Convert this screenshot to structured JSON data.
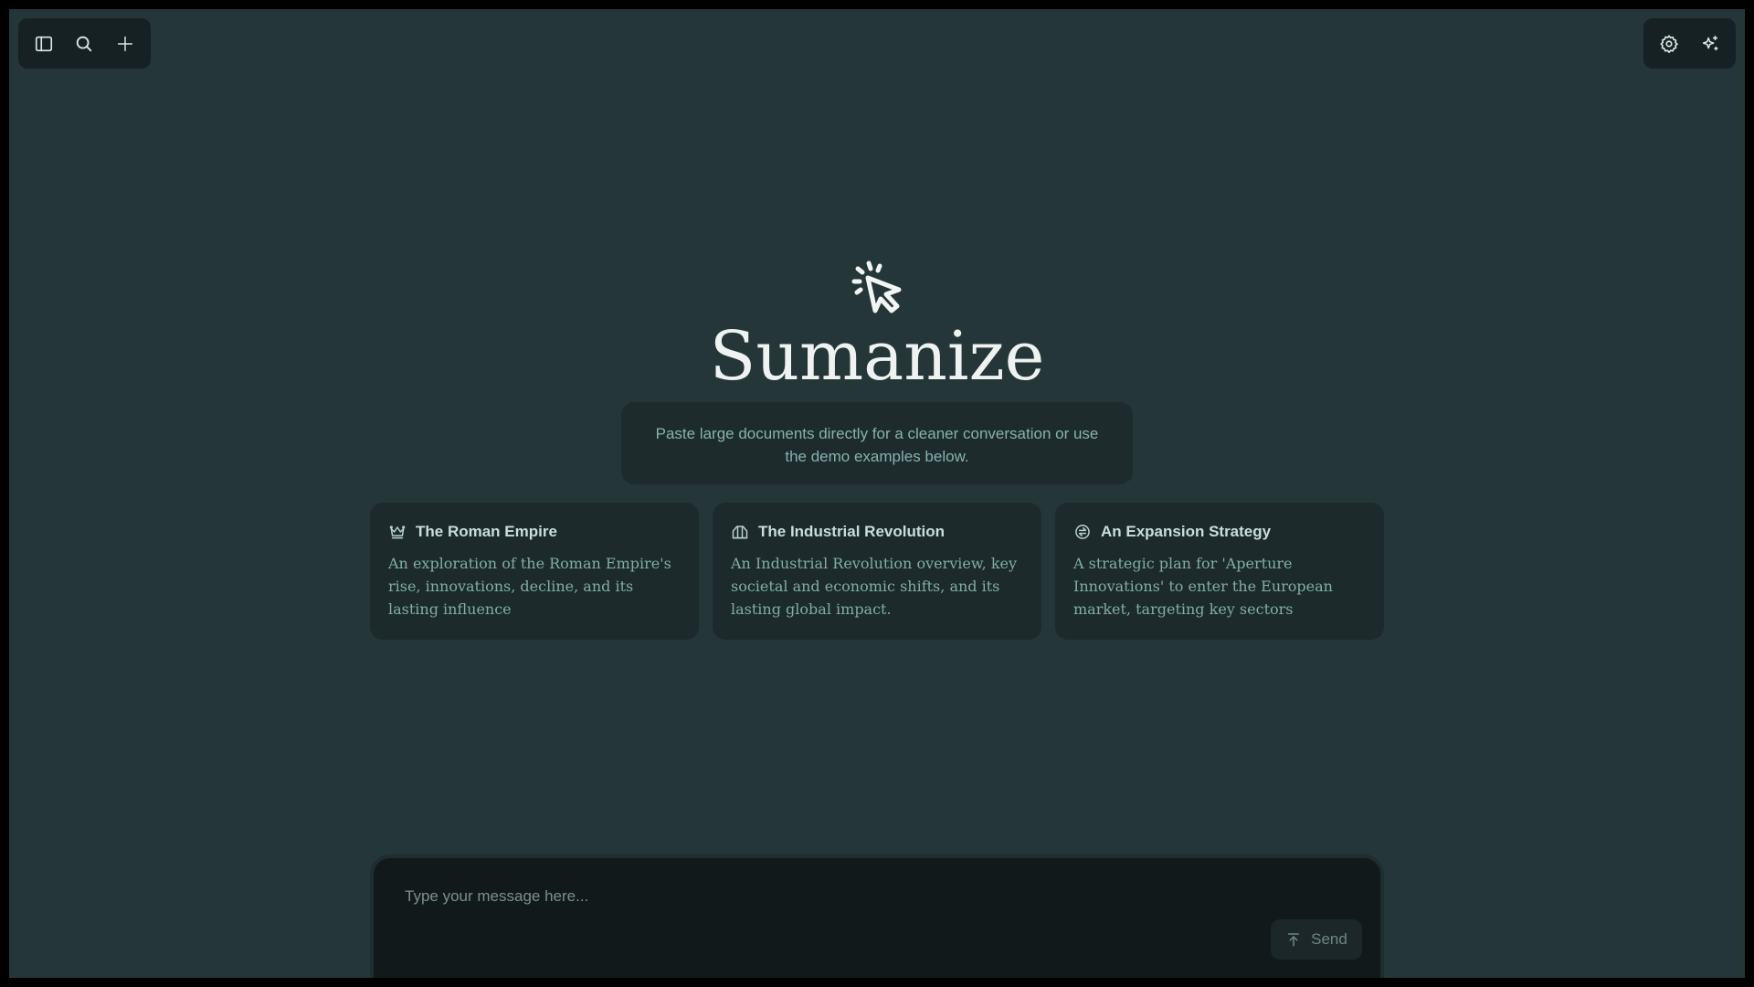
{
  "toolbar_left": {
    "sidebar_icon": "sidebar-toggle-icon",
    "search_icon": "search-icon",
    "new_icon": "plus-icon"
  },
  "toolbar_right": {
    "settings_icon": "gear-icon",
    "sparkle_icon": "sparkles-icon"
  },
  "hero": {
    "icon": "cursor-click-icon",
    "title": "Sumanize",
    "subtitle": "Paste large documents directly for a cleaner conversation or use the demo examples below."
  },
  "cards": [
    {
      "icon": "crown-icon",
      "title": "The Roman Empire",
      "description": "An exploration of the Roman Empire's rise, innovations, decline, and its lasting influence"
    },
    {
      "icon": "factory-icon",
      "title": "The Industrial Revolution",
      "description": "An Industrial Revolution overview, key societal and economic shifts, and its lasting global impact."
    },
    {
      "icon": "rocket-icon",
      "title": "An Expansion Strategy",
      "description": "A strategic plan for 'Aperture Innovations' to enter the European market, targeting key sectors"
    }
  ],
  "composer": {
    "placeholder": "Type your message here...",
    "value": "",
    "send_label": "Send",
    "send_icon": "arrow-up-icon"
  },
  "colors": {
    "background": "#243637",
    "panel": "#1c2a2c",
    "composer": "#11191b",
    "accent_text": "#86b2ad"
  }
}
